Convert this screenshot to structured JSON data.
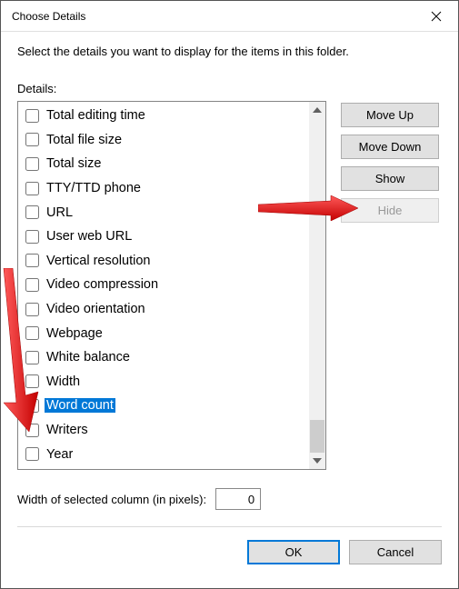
{
  "window": {
    "title": "Choose Details",
    "instruction": "Select the details you want to display for the items in this folder.",
    "details_label": "Details:"
  },
  "details": [
    {
      "label": "Total editing time",
      "checked": false,
      "selected": false
    },
    {
      "label": "Total file size",
      "checked": false,
      "selected": false
    },
    {
      "label": "Total size",
      "checked": false,
      "selected": false
    },
    {
      "label": "TTY/TTD phone",
      "checked": false,
      "selected": false
    },
    {
      "label": "URL",
      "checked": false,
      "selected": false
    },
    {
      "label": "User web URL",
      "checked": false,
      "selected": false
    },
    {
      "label": "Vertical resolution",
      "checked": false,
      "selected": false
    },
    {
      "label": "Video compression",
      "checked": false,
      "selected": false
    },
    {
      "label": "Video orientation",
      "checked": false,
      "selected": false
    },
    {
      "label": "Webpage",
      "checked": false,
      "selected": false
    },
    {
      "label": "White balance",
      "checked": false,
      "selected": false
    },
    {
      "label": "Width",
      "checked": false,
      "selected": false
    },
    {
      "label": "Word count",
      "checked": false,
      "selected": true
    },
    {
      "label": "Writers",
      "checked": false,
      "selected": false
    },
    {
      "label": "Year",
      "checked": false,
      "selected": false
    }
  ],
  "buttons": {
    "move_up": "Move Up",
    "move_down": "Move Down",
    "show": "Show",
    "hide": "Hide",
    "ok": "OK",
    "cancel": "Cancel"
  },
  "width_field": {
    "label": "Width of selected column (in pixels):",
    "value": "0"
  }
}
